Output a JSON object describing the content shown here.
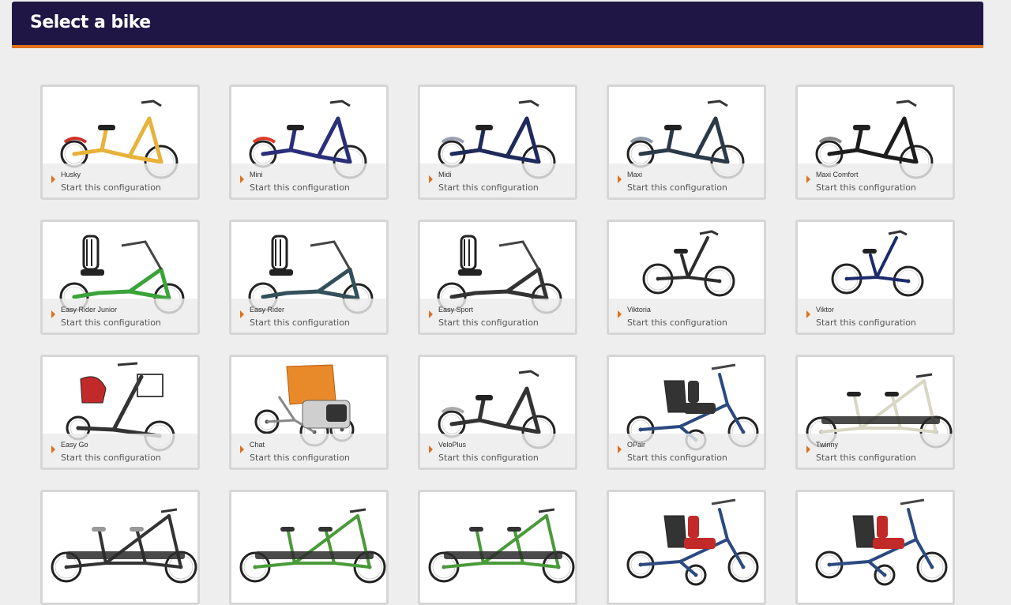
{
  "header": {
    "title": "Select a bike"
  },
  "cta": "Start this configuration",
  "bikes": [
    {
      "name": "Husky",
      "type": "trike",
      "color": "#e8b23a",
      "accent": "#d0302a"
    },
    {
      "name": "Mini",
      "type": "trike",
      "color": "#2a2f7a",
      "accent": "#e03a2a"
    },
    {
      "name": "Midi",
      "type": "trike",
      "color": "#1f2a5c",
      "accent": "#9aa0b0"
    },
    {
      "name": "Maxi",
      "type": "trike",
      "color": "#2b3a48",
      "accent": "#8a9aa8"
    },
    {
      "name": "Maxi Comfort",
      "type": "trike",
      "color": "#1d1d1d",
      "accent": "#888888"
    },
    {
      "name": "Easy Rider Junior",
      "type": "recumbent",
      "color": "#3aa33a",
      "accent": "#222222"
    },
    {
      "name": "Easy Rider",
      "type": "recumbent",
      "color": "#33505a",
      "accent": "#222222"
    },
    {
      "name": "Easy Sport",
      "type": "recumbent",
      "color": "#333333",
      "accent": "#888888"
    },
    {
      "name": "Viktoria",
      "type": "folding",
      "color": "#2c2c2c",
      "accent": "#888888"
    },
    {
      "name": "Viktor",
      "type": "folding",
      "color": "#1c2a6c",
      "accent": "#888888"
    },
    {
      "name": "Easy Go",
      "type": "scooter",
      "color": "#333333",
      "accent": "#c22a2a"
    },
    {
      "name": "Chat",
      "type": "rickshaw",
      "color": "#e88a2a",
      "accent": "#888888"
    },
    {
      "name": "VeloPlus",
      "type": "trike",
      "color": "#333333",
      "accent": "#aaaaaa"
    },
    {
      "name": "OPair",
      "type": "opair",
      "color": "#2a4a80",
      "accent": "#333333"
    },
    {
      "name": "Twinny",
      "type": "tandem",
      "color": "#d8d6c4",
      "accent": "#222222"
    },
    {
      "name": "",
      "type": "tandem",
      "color": "#333333",
      "accent": "#999999"
    },
    {
      "name": "",
      "type": "tandem",
      "color": "#4a9a3a",
      "accent": "#333333"
    },
    {
      "name": "",
      "type": "tandem",
      "color": "#4a9a3a",
      "accent": "#333333"
    },
    {
      "name": "",
      "type": "opair",
      "color": "#2a4a80",
      "accent": "#c22a2a"
    },
    {
      "name": "",
      "type": "opair",
      "color": "#2a4a80",
      "accent": "#c22a2a"
    }
  ]
}
